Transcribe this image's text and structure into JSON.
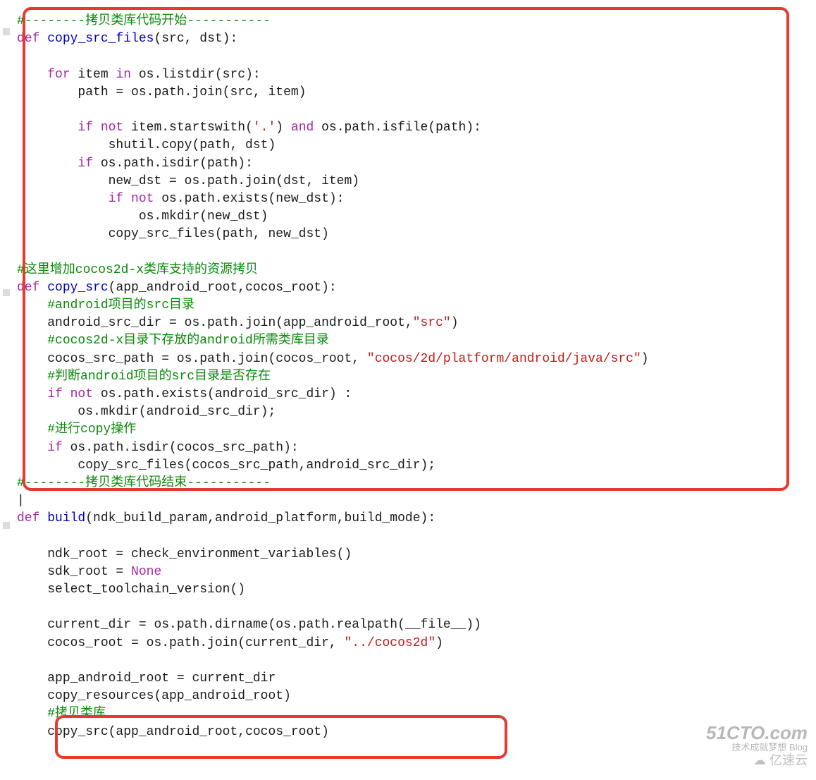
{
  "code": {
    "lines": [
      {
        "indent": 0,
        "segs": [
          {
            "cls": "cm",
            "t": "#--------拷贝类库代码开始-----------"
          }
        ]
      },
      {
        "indent": 0,
        "segs": [
          {
            "cls": "kw",
            "t": "def "
          },
          {
            "cls": "fn",
            "t": "copy_src_files"
          },
          {
            "cls": "txt",
            "t": "(src, dst):"
          }
        ]
      },
      {
        "indent": 0,
        "segs": [
          {
            "cls": "txt",
            "t": ""
          }
        ]
      },
      {
        "indent": 1,
        "segs": [
          {
            "cls": "kw",
            "t": "for"
          },
          {
            "cls": "txt",
            "t": " item "
          },
          {
            "cls": "kw",
            "t": "in"
          },
          {
            "cls": "txt",
            "t": " os.listdir(src):"
          }
        ]
      },
      {
        "indent": 2,
        "segs": [
          {
            "cls": "txt",
            "t": "path = os.path.join(src, item)"
          }
        ]
      },
      {
        "indent": 0,
        "segs": [
          {
            "cls": "txt",
            "t": ""
          }
        ]
      },
      {
        "indent": 2,
        "segs": [
          {
            "cls": "kw",
            "t": "if not"
          },
          {
            "cls": "txt",
            "t": " item.startswith("
          },
          {
            "cls": "str",
            "t": "'.'"
          },
          {
            "cls": "txt",
            "t": ") "
          },
          {
            "cls": "kw",
            "t": "and"
          },
          {
            "cls": "txt",
            "t": " os.path.isfile(path):"
          }
        ]
      },
      {
        "indent": 3,
        "segs": [
          {
            "cls": "txt",
            "t": "shutil.copy(path, dst)"
          }
        ]
      },
      {
        "indent": 2,
        "segs": [
          {
            "cls": "kw",
            "t": "if"
          },
          {
            "cls": "txt",
            "t": " os.path.isdir(path):"
          }
        ]
      },
      {
        "indent": 3,
        "segs": [
          {
            "cls": "txt",
            "t": "new_dst = os.path.join(dst, item)"
          }
        ]
      },
      {
        "indent": 3,
        "segs": [
          {
            "cls": "kw",
            "t": "if not"
          },
          {
            "cls": "txt",
            "t": " os.path.exists(new_dst):"
          }
        ]
      },
      {
        "indent": 4,
        "segs": [
          {
            "cls": "txt",
            "t": "os.mkdir(new_dst)"
          }
        ]
      },
      {
        "indent": 3,
        "segs": [
          {
            "cls": "txt",
            "t": "copy_src_files(path, new_dst)"
          }
        ]
      },
      {
        "indent": 0,
        "segs": [
          {
            "cls": "txt",
            "t": ""
          }
        ]
      },
      {
        "indent": 0,
        "segs": [
          {
            "cls": "cm",
            "t": "#这里增加cocos2d-x类库支持的资源拷贝"
          }
        ]
      },
      {
        "indent": 0,
        "segs": [
          {
            "cls": "kw",
            "t": "def "
          },
          {
            "cls": "fn",
            "t": "copy_src"
          },
          {
            "cls": "txt",
            "t": "(app_android_root,cocos_root):"
          }
        ]
      },
      {
        "indent": 1,
        "segs": [
          {
            "cls": "cm",
            "t": "#android项目的src目录"
          }
        ]
      },
      {
        "indent": 1,
        "segs": [
          {
            "cls": "txt",
            "t": "android_src_dir = os.path.join(app_android_root,"
          },
          {
            "cls": "str",
            "t": "\"src\""
          },
          {
            "cls": "txt",
            "t": ")"
          }
        ]
      },
      {
        "indent": 1,
        "segs": [
          {
            "cls": "cm",
            "t": "#cocos2d-x目录下存放的android所需类库目录"
          }
        ]
      },
      {
        "indent": 1,
        "segs": [
          {
            "cls": "txt",
            "t": "cocos_src_path = os.path.join(cocos_root, "
          },
          {
            "cls": "str",
            "t": "\"cocos/2d/platform/android/java/src\""
          },
          {
            "cls": "txt",
            "t": ")"
          }
        ]
      },
      {
        "indent": 1,
        "segs": [
          {
            "cls": "cm",
            "t": "#判断android项目的src目录是否存在"
          }
        ]
      },
      {
        "indent": 1,
        "segs": [
          {
            "cls": "kw",
            "t": "if not"
          },
          {
            "cls": "txt",
            "t": " os.path.exists(android_src_dir) :"
          }
        ]
      },
      {
        "indent": 2,
        "segs": [
          {
            "cls": "txt",
            "t": "os.mkdir(android_src_dir);"
          }
        ]
      },
      {
        "indent": 1,
        "segs": [
          {
            "cls": "cm",
            "t": "#进行copy操作"
          }
        ]
      },
      {
        "indent": 1,
        "segs": [
          {
            "cls": "kw",
            "t": "if"
          },
          {
            "cls": "txt",
            "t": " os.path.isdir(cocos_src_path):"
          }
        ]
      },
      {
        "indent": 2,
        "segs": [
          {
            "cls": "txt",
            "t": "copy_src_files(cocos_src_path,android_src_dir);"
          }
        ]
      },
      {
        "indent": 0,
        "segs": [
          {
            "cls": "cm",
            "t": "#--------拷贝类库代码结束-----------"
          }
        ]
      },
      {
        "indent": 0,
        "segs": [
          {
            "cls": "txt",
            "t": "|"
          }
        ]
      },
      {
        "indent": 0,
        "segs": [
          {
            "cls": "kw",
            "t": "def "
          },
          {
            "cls": "fn",
            "t": "build"
          },
          {
            "cls": "txt",
            "t": "(ndk_build_param,android_platform,build_mode):"
          }
        ]
      },
      {
        "indent": 0,
        "segs": [
          {
            "cls": "txt",
            "t": ""
          }
        ]
      },
      {
        "indent": 1,
        "segs": [
          {
            "cls": "txt",
            "t": "ndk_root = check_environment_variables()"
          }
        ]
      },
      {
        "indent": 1,
        "segs": [
          {
            "cls": "txt",
            "t": "sdk_root = "
          },
          {
            "cls": "none",
            "t": "None"
          }
        ]
      },
      {
        "indent": 1,
        "segs": [
          {
            "cls": "txt",
            "t": "select_toolchain_version()"
          }
        ]
      },
      {
        "indent": 0,
        "segs": [
          {
            "cls": "txt",
            "t": ""
          }
        ]
      },
      {
        "indent": 1,
        "segs": [
          {
            "cls": "txt",
            "t": "current_dir = os.path.dirname(os.path.realpath(__file__))"
          }
        ]
      },
      {
        "indent": 1,
        "segs": [
          {
            "cls": "txt",
            "t": "cocos_root = os.path.join(current_dir, "
          },
          {
            "cls": "str",
            "t": "\"../cocos2d\""
          },
          {
            "cls": "txt",
            "t": ")"
          }
        ]
      },
      {
        "indent": 0,
        "segs": [
          {
            "cls": "txt",
            "t": ""
          }
        ]
      },
      {
        "indent": 1,
        "segs": [
          {
            "cls": "txt",
            "t": "app_android_root = current_dir"
          }
        ]
      },
      {
        "indent": 1,
        "segs": [
          {
            "cls": "txt",
            "t": "copy_resources(app_android_root)"
          }
        ]
      },
      {
        "indent": 1,
        "segs": [
          {
            "cls": "cm",
            "t": "#拷贝类库"
          }
        ]
      },
      {
        "indent": 1,
        "segs": [
          {
            "cls": "txt",
            "t": "copy_src(app_android_root,cocos_root)"
          }
        ]
      }
    ]
  },
  "folds": [
    40,
    410,
    740
  ],
  "indent_unit": "    ",
  "watermark": {
    "big": "51CTO.com",
    "small": "技术成就梦想   Blog",
    "brand": "亿速云"
  }
}
